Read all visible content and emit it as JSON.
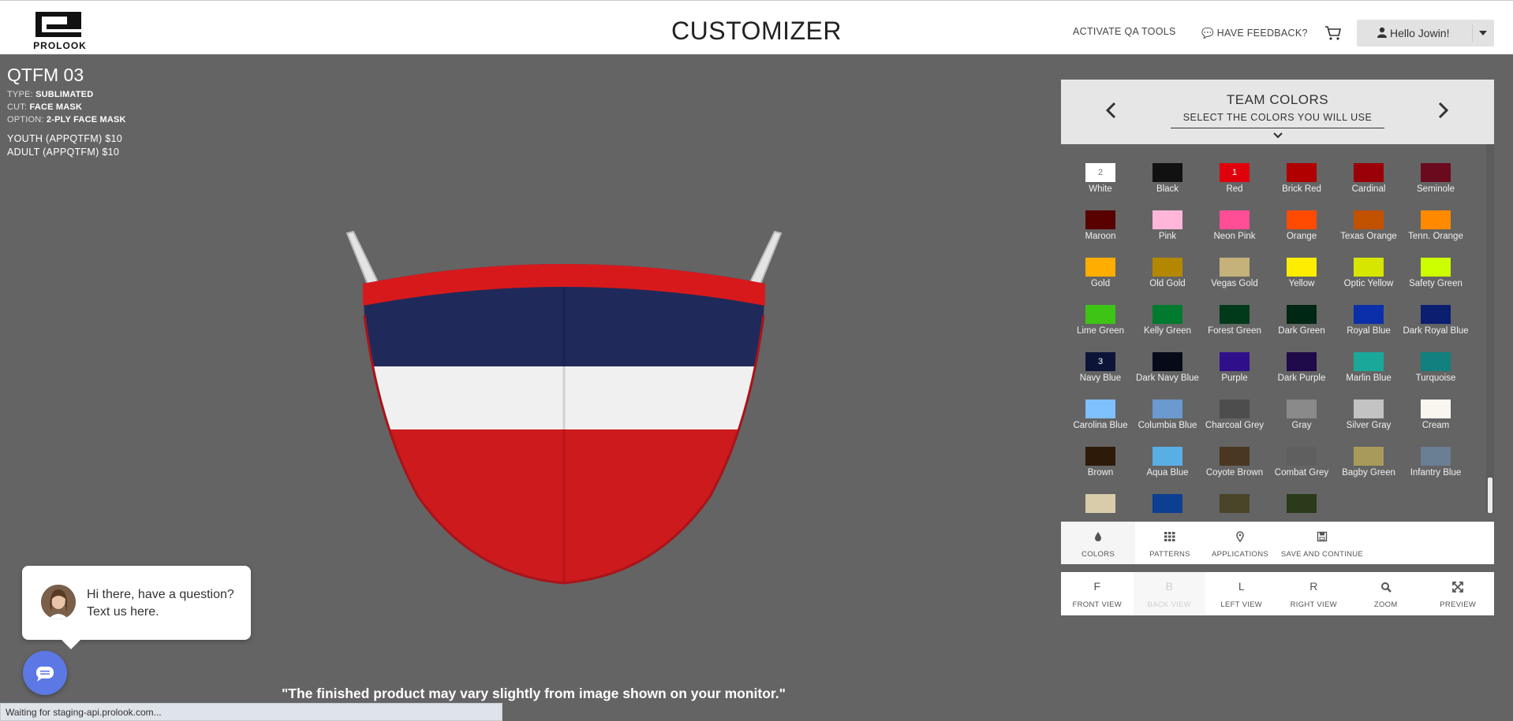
{
  "header": {
    "logo_text": "PROLOOK",
    "title": "CUSTOMIZER",
    "qa_tools": "ACTIVATE QA TOOLS",
    "feedback": "HAVE FEEDBACK?",
    "user": "Hello Jowin!"
  },
  "product": {
    "title": "QTFM 03",
    "type_label": "TYPE:",
    "type_value": "SUBLIMATED",
    "cut_label": "CUT:",
    "cut_value": "FACE MASK",
    "option_label": "OPTION:",
    "option_value": "2-PLY FACE MASK",
    "price_youth": "YOUTH (APPQTFM) $10",
    "price_adult": "ADULT  (APPQTFM) $10"
  },
  "mask_colors": {
    "top": "#1f2a5a",
    "middle": "#f0f0f0",
    "bottom": "#cc1a1d",
    "trim": "#d8191c"
  },
  "disclaimer": "\"The finished product may vary slightly from image shown on your monitor.\"",
  "status_bar": "Waiting for staging-api.prolook.com...",
  "chat": {
    "message": "Hi there, have a question? Text us here."
  },
  "panel": {
    "title": "TEAM COLORS",
    "subtitle": "SELECT THE COLORS YOU WILL USE",
    "colors": [
      {
        "name": "White",
        "hex": "#ffffff",
        "badge": "2"
      },
      {
        "name": "Black",
        "hex": "#111111",
        "badge": ""
      },
      {
        "name": "Red",
        "hex": "#e0000c",
        "badge": "1"
      },
      {
        "name": "Brick Red",
        "hex": "#b00000",
        "badge": ""
      },
      {
        "name": "Cardinal",
        "hex": "#9a0008",
        "badge": ""
      },
      {
        "name": "Seminole",
        "hex": "#6b0a1e",
        "badge": ""
      },
      {
        "name": "Maroon",
        "hex": "#590000",
        "badge": ""
      },
      {
        "name": "Pink",
        "hex": "#ffb6d9",
        "badge": ""
      },
      {
        "name": "Neon Pink",
        "hex": "#ff4d96",
        "badge": ""
      },
      {
        "name": "Orange",
        "hex": "#ff4a00",
        "badge": ""
      },
      {
        "name": "Texas Orange",
        "hex": "#c25100",
        "badge": ""
      },
      {
        "name": "Tenn. Orange",
        "hex": "#ff8a00",
        "badge": ""
      },
      {
        "name": "Gold",
        "hex": "#ffad00",
        "badge": ""
      },
      {
        "name": "Old Gold",
        "hex": "#b38700",
        "badge": ""
      },
      {
        "name": "Vegas Gold",
        "hex": "#c4b27a",
        "badge": ""
      },
      {
        "name": "Yellow",
        "hex": "#ffed00",
        "badge": ""
      },
      {
        "name": "Optic Yellow",
        "hex": "#d6e600",
        "badge": ""
      },
      {
        "name": "Safety Green",
        "hex": "#ccff00",
        "badge": ""
      },
      {
        "name": "Lime Green",
        "hex": "#3ec414",
        "badge": ""
      },
      {
        "name": "Kelly Green",
        "hex": "#007a2e",
        "badge": ""
      },
      {
        "name": "Forest Green",
        "hex": "#003a1a",
        "badge": ""
      },
      {
        "name": "Dark Green",
        "hex": "#002614",
        "badge": ""
      },
      {
        "name": "Royal Blue",
        "hex": "#0a2fa8",
        "badge": ""
      },
      {
        "name": "Dark Royal Blue",
        "hex": "#0b1e70",
        "badge": ""
      },
      {
        "name": "Navy Blue",
        "hex": "#0c1538",
        "badge": "3"
      },
      {
        "name": "Dark Navy Blue",
        "hex": "#060b1a",
        "badge": ""
      },
      {
        "name": "Purple",
        "hex": "#30108a",
        "badge": ""
      },
      {
        "name": "Dark Purple",
        "hex": "#1f0a4a",
        "badge": ""
      },
      {
        "name": "Marlin Blue",
        "hex": "#1aa89a",
        "badge": ""
      },
      {
        "name": "Turquoise",
        "hex": "#11807e",
        "badge": ""
      },
      {
        "name": "Carolina Blue",
        "hex": "#7fc0ff",
        "badge": ""
      },
      {
        "name": "Columbia Blue",
        "hex": "#6a9ad0",
        "badge": ""
      },
      {
        "name": "Charcoal Grey",
        "hex": "#4d4d4d",
        "badge": ""
      },
      {
        "name": "Gray",
        "hex": "#8a8a8a",
        "badge": ""
      },
      {
        "name": "Silver Gray",
        "hex": "#c3c3c3",
        "badge": ""
      },
      {
        "name": "Cream",
        "hex": "#f8f6ee",
        "badge": ""
      },
      {
        "name": "Brown",
        "hex": "#2e1a08",
        "badge": ""
      },
      {
        "name": "Aqua Blue",
        "hex": "#5aaee6",
        "badge": ""
      },
      {
        "name": "Coyote Brown",
        "hex": "#4a3722",
        "badge": ""
      },
      {
        "name": "Combat Grey",
        "hex": "#5f5f5f",
        "badge": ""
      },
      {
        "name": "Bagby Green",
        "hex": "#a89a5a",
        "badge": ""
      },
      {
        "name": "Infantry Blue",
        "hex": "#6a7e94",
        "badge": ""
      },
      {
        "name": "",
        "hex": "#d8ccaa",
        "badge": ""
      },
      {
        "name": "",
        "hex": "#0c3f92",
        "badge": ""
      },
      {
        "name": "",
        "hex": "#4a4428",
        "badge": ""
      },
      {
        "name": "",
        "hex": "#2a3a1a",
        "badge": ""
      }
    ]
  },
  "tabs": [
    {
      "label": "COLORS",
      "icon": "drop-icon",
      "active": true
    },
    {
      "label": "PATTERNS",
      "icon": "grid-icon",
      "active": false
    },
    {
      "label": "APPLICATIONS",
      "icon": "map-marker-icon",
      "active": false
    },
    {
      "label": "SAVE AND CONTINUE",
      "icon": "floppy-icon",
      "active": false
    }
  ],
  "views": [
    {
      "key": "F",
      "label": "FRONT VIEW",
      "disabled": false
    },
    {
      "key": "B",
      "label": "BACK VIEW",
      "disabled": true
    },
    {
      "key": "L",
      "label": "LEFT VIEW",
      "disabled": false
    },
    {
      "key": "R",
      "label": "RIGHT VIEW",
      "disabled": false
    },
    {
      "key": "",
      "label": "ZOOM",
      "icon": "search-icon",
      "disabled": false
    },
    {
      "key": "",
      "label": "PREVIEW",
      "icon": "expand-icon",
      "disabled": false
    }
  ]
}
